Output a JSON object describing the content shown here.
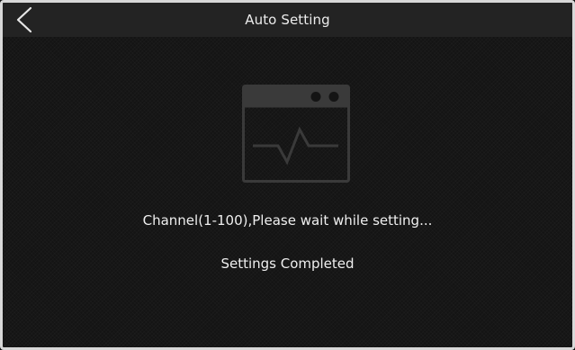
{
  "header": {
    "title": "Auto Setting",
    "back_icon": "chevron-left-icon"
  },
  "main": {
    "illustration_icon": "window-waveform-icon",
    "progress_message": "Channel(1-100),Please wait while setting...",
    "completion_message": "Settings Completed"
  },
  "colors": {
    "background": "#141414",
    "titlebar": "#232323",
    "text": "#ececec",
    "icon": "#3a3a3a",
    "frame": "#d8d8d8"
  }
}
